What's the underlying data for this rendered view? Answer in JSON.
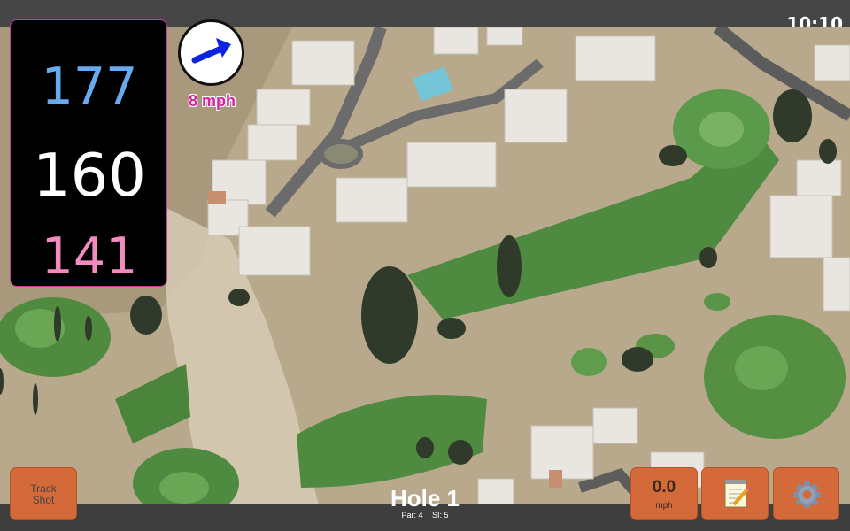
{
  "status_bar": {
    "time": "10:10"
  },
  "distances": {
    "back": "177",
    "center": "160",
    "front": "141"
  },
  "wind": {
    "speed_label": "8 mph",
    "icon": "arrow-icon"
  },
  "buttons": {
    "track_shot_label_line1": "Track",
    "track_shot_label_line2": "Shot",
    "speed_value": "0.0",
    "speed_unit": "mph",
    "notes_icon": "notepad-icon",
    "settings_icon": "gear-icon"
  },
  "hole": {
    "title": "Hole 1",
    "par": "Par: 4",
    "si": "SI: 5"
  },
  "colors": {
    "accent": "#c23f9c",
    "back_distance": "#66aaf0",
    "front_distance": "#f28bc0",
    "button": "#d4693a",
    "wind_arrow": "#0b24e0"
  }
}
